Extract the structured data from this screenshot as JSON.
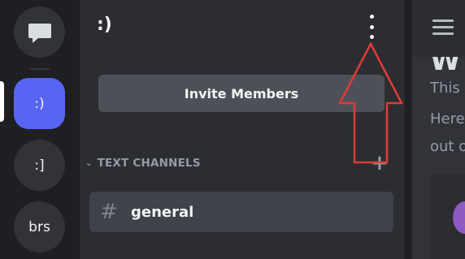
{
  "servers": [
    {
      "label": ""
    },
    {
      "label": ":)"
    },
    {
      "label": ":]"
    },
    {
      "label": "brs"
    }
  ],
  "channel_panel": {
    "server_name": ":)",
    "invite_button": "Invite Members",
    "category_label": "TEXT CHANNELS",
    "channels": [
      {
        "label": "general",
        "icon": "hash-icon"
      }
    ]
  },
  "chat": {
    "heading_partial": "W",
    "lines": [
      "This",
      "Here",
      "out o"
    ]
  },
  "colors": {
    "accent": "#5865f2",
    "annotation": "#e53935"
  }
}
